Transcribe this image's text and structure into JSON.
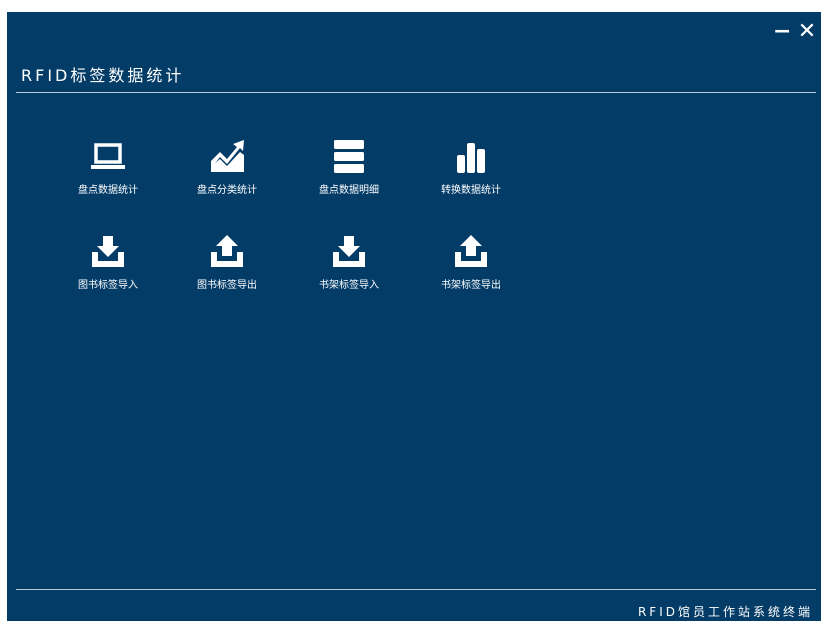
{
  "window": {
    "title": "RFID标签数据统计",
    "minimize_glyph": "−",
    "close_glyph": "✕",
    "footer": "RFID馆员工作站系统终端",
    "colors": {
      "background": "#043c68",
      "divider": "#b8c9d8",
      "text": "#ffffff"
    }
  },
  "tiles": [
    {
      "label": "盘点数据统计",
      "icon": "laptop-icon"
    },
    {
      "label": "盘点分类统计",
      "icon": "trend-chart-icon"
    },
    {
      "label": "盘点数据明细",
      "icon": "stacked-list-icon"
    },
    {
      "label": "转换数据统计",
      "icon": "bar-chart-icon"
    },
    {
      "label": "图书标签导入",
      "icon": "download-tray-icon"
    },
    {
      "label": "图书标签导出",
      "icon": "upload-tray-icon"
    },
    {
      "label": "书架标签导入",
      "icon": "download-tray-icon"
    },
    {
      "label": "书架标签导出",
      "icon": "upload-tray-icon"
    }
  ]
}
